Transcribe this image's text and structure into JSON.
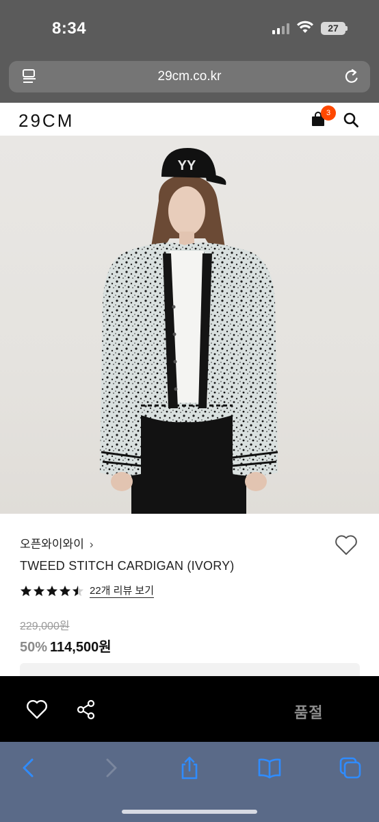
{
  "status_bar": {
    "time": "8:34",
    "battery": "27",
    "icons": [
      "signal-icon",
      "wifi-icon",
      "battery-icon"
    ]
  },
  "browser": {
    "url": "29cm.co.kr",
    "icons": [
      "reader-icon",
      "reload-icon"
    ],
    "toolbar_icons": [
      "back-icon",
      "forward-icon",
      "share-icon",
      "bookmarks-icon",
      "tabs-icon"
    ]
  },
  "site_header": {
    "logo": "29CM",
    "cart_count": "3",
    "icons": [
      "shopping-bag-icon",
      "search-icon"
    ]
  },
  "product": {
    "brand": "오픈와이와이",
    "brand_chevron": "›",
    "name": "TWEED STITCH CARDIGAN (IVORY)",
    "rating": 4.5,
    "review_link": "22개 리뷰 보기",
    "original_price": "229,000원",
    "discount": "50%",
    "sale_price": "114,500원",
    "cap_logo": "YY"
  },
  "action_bar": {
    "soldout_label": "품절",
    "icons": [
      "heart-icon",
      "share-icon"
    ]
  },
  "colors": {
    "browser_chrome": "#5b5b5b",
    "toolbar_bg": "#5a6a88",
    "badge": "#ff4800",
    "action_bar": "#000000"
  }
}
